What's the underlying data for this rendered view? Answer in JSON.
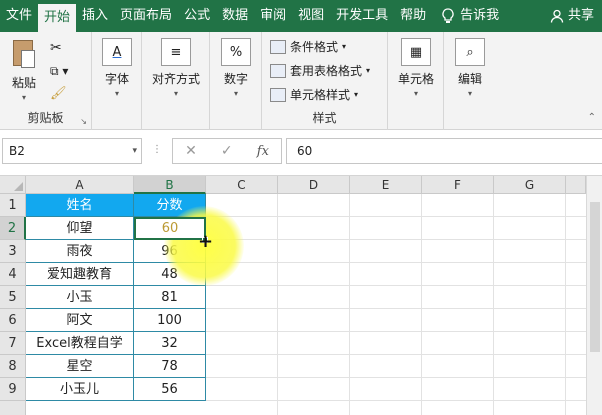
{
  "ribbon_tabs": {
    "file": "文件",
    "home": "开始",
    "insert": "插入",
    "page_layout": "页面布局",
    "formulas": "公式",
    "data": "数据",
    "review": "审阅",
    "view": "视图",
    "developer": "开发工具",
    "help": "帮助",
    "tell_me": "告诉我",
    "share": "共享"
  },
  "ribbon": {
    "paste": "粘贴",
    "clipboard": "剪贴板",
    "font": "字体",
    "alignment": "对齐方式",
    "number": "数字",
    "conditional_formatting": "条件格式",
    "format_as_table": "套用表格格式",
    "cell_styles": "单元格样式",
    "styles": "样式",
    "cells": "单元格",
    "editing": "编辑"
  },
  "formula_bar": {
    "name_box": "B2",
    "formula": "60"
  },
  "columns": [
    "A",
    "B",
    "C",
    "D",
    "E",
    "F",
    "G"
  ],
  "rows": [
    "1",
    "2",
    "3",
    "4",
    "5",
    "6",
    "7",
    "8",
    "9"
  ],
  "table": {
    "headers": [
      "姓名",
      "分数"
    ],
    "rows": [
      [
        "仰望",
        "60"
      ],
      [
        "雨夜",
        "96"
      ],
      [
        "爱知趣教育",
        "48"
      ],
      [
        "小玉",
        "81"
      ],
      [
        "阿文",
        "100"
      ],
      [
        "Excel教程自学",
        "32"
      ],
      [
        "星空",
        "78"
      ],
      [
        "小玉儿",
        "56"
      ]
    ]
  },
  "colors": {
    "accent": "#217346",
    "table_header": "#12a8ef",
    "table_border": "#2e8aa5"
  }
}
